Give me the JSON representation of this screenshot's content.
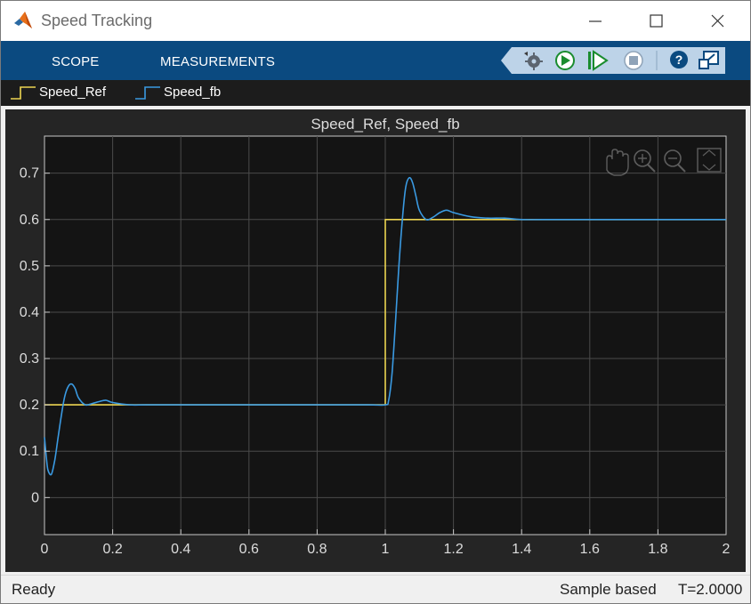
{
  "window": {
    "title": "Speed Tracking"
  },
  "toolstrip": {
    "tabs": [
      {
        "label": "SCOPE"
      },
      {
        "label": "MEASUREMENTS"
      }
    ],
    "buttons": [
      "settings-gear-icon",
      "run-icon",
      "step-forward-icon",
      "stop-icon",
      "help-icon",
      "undock-icon"
    ]
  },
  "legend": {
    "items": [
      {
        "label": "Speed_Ref",
        "color": "#ecd451"
      },
      {
        "label": "Speed_fb",
        "color": "#3a9ae2"
      }
    ]
  },
  "plot_tools": [
    "pan-hand-icon",
    "zoom-in-icon",
    "zoom-out-icon",
    "fit-to-view-icon"
  ],
  "status": {
    "left": "Ready",
    "mode": "Sample based",
    "time": "T=2.0000"
  },
  "colors": {
    "toolstrip": "#0b4a80",
    "plot_background": "#141414",
    "figure_background": "#252525",
    "grid": "#4a4a4a",
    "axis": "#c8c8c8"
  },
  "chart_data": {
    "type": "line",
    "title": "Speed_Ref, Speed_fb",
    "xlabel": "",
    "ylabel": "",
    "xlim": [
      0,
      2
    ],
    "ylim": [
      -0.08,
      0.78
    ],
    "xticks": [
      0,
      0.2,
      0.4,
      0.6,
      0.8,
      1,
      1.2,
      1.4,
      1.6,
      1.8,
      2
    ],
    "xtick_labels": [
      "0",
      "0.2",
      "0.4",
      "0.6",
      "0.8",
      "1",
      "1.2",
      "1.4",
      "1.6",
      "1.8",
      "2"
    ],
    "yticks": [
      0,
      0.1,
      0.2,
      0.3,
      0.4,
      0.5,
      0.6,
      0.7
    ],
    "ytick_labels": [
      "0",
      "0.1",
      "0.2",
      "0.3",
      "0.4",
      "0.5",
      "0.6",
      "0.7"
    ],
    "grid": true,
    "series": [
      {
        "name": "Speed_Ref",
        "color": "#ecd451",
        "x": [
          0,
          1.0,
          1.0,
          2.0
        ],
        "y": [
          0.2,
          0.2,
          0.6,
          0.6
        ]
      },
      {
        "name": "Speed_fb",
        "color": "#3a9ae2",
        "x": [
          0,
          0.005,
          0.01,
          0.02,
          0.03,
          0.04,
          0.05,
          0.06,
          0.07,
          0.08,
          0.09,
          0.1,
          0.12,
          0.14,
          0.16,
          0.18,
          0.2,
          0.25,
          0.3,
          0.4,
          0.6,
          0.8,
          0.95,
          1.0,
          1.01,
          1.02,
          1.03,
          1.04,
          1.05,
          1.06,
          1.07,
          1.08,
          1.09,
          1.1,
          1.12,
          1.14,
          1.16,
          1.18,
          1.2,
          1.25,
          1.3,
          1.35,
          1.4,
          1.5,
          1.6,
          2.0
        ],
        "y": [
          0.13,
          0.09,
          0.06,
          0.05,
          0.08,
          0.13,
          0.18,
          0.22,
          0.24,
          0.245,
          0.235,
          0.215,
          0.2,
          0.203,
          0.207,
          0.21,
          0.205,
          0.2,
          0.2,
          0.2,
          0.2,
          0.2,
          0.2,
          0.2,
          0.21,
          0.27,
          0.38,
          0.5,
          0.6,
          0.67,
          0.69,
          0.68,
          0.65,
          0.62,
          0.6,
          0.605,
          0.615,
          0.62,
          0.615,
          0.606,
          0.603,
          0.603,
          0.6,
          0.6,
          0.6,
          0.6
        ]
      }
    ]
  }
}
